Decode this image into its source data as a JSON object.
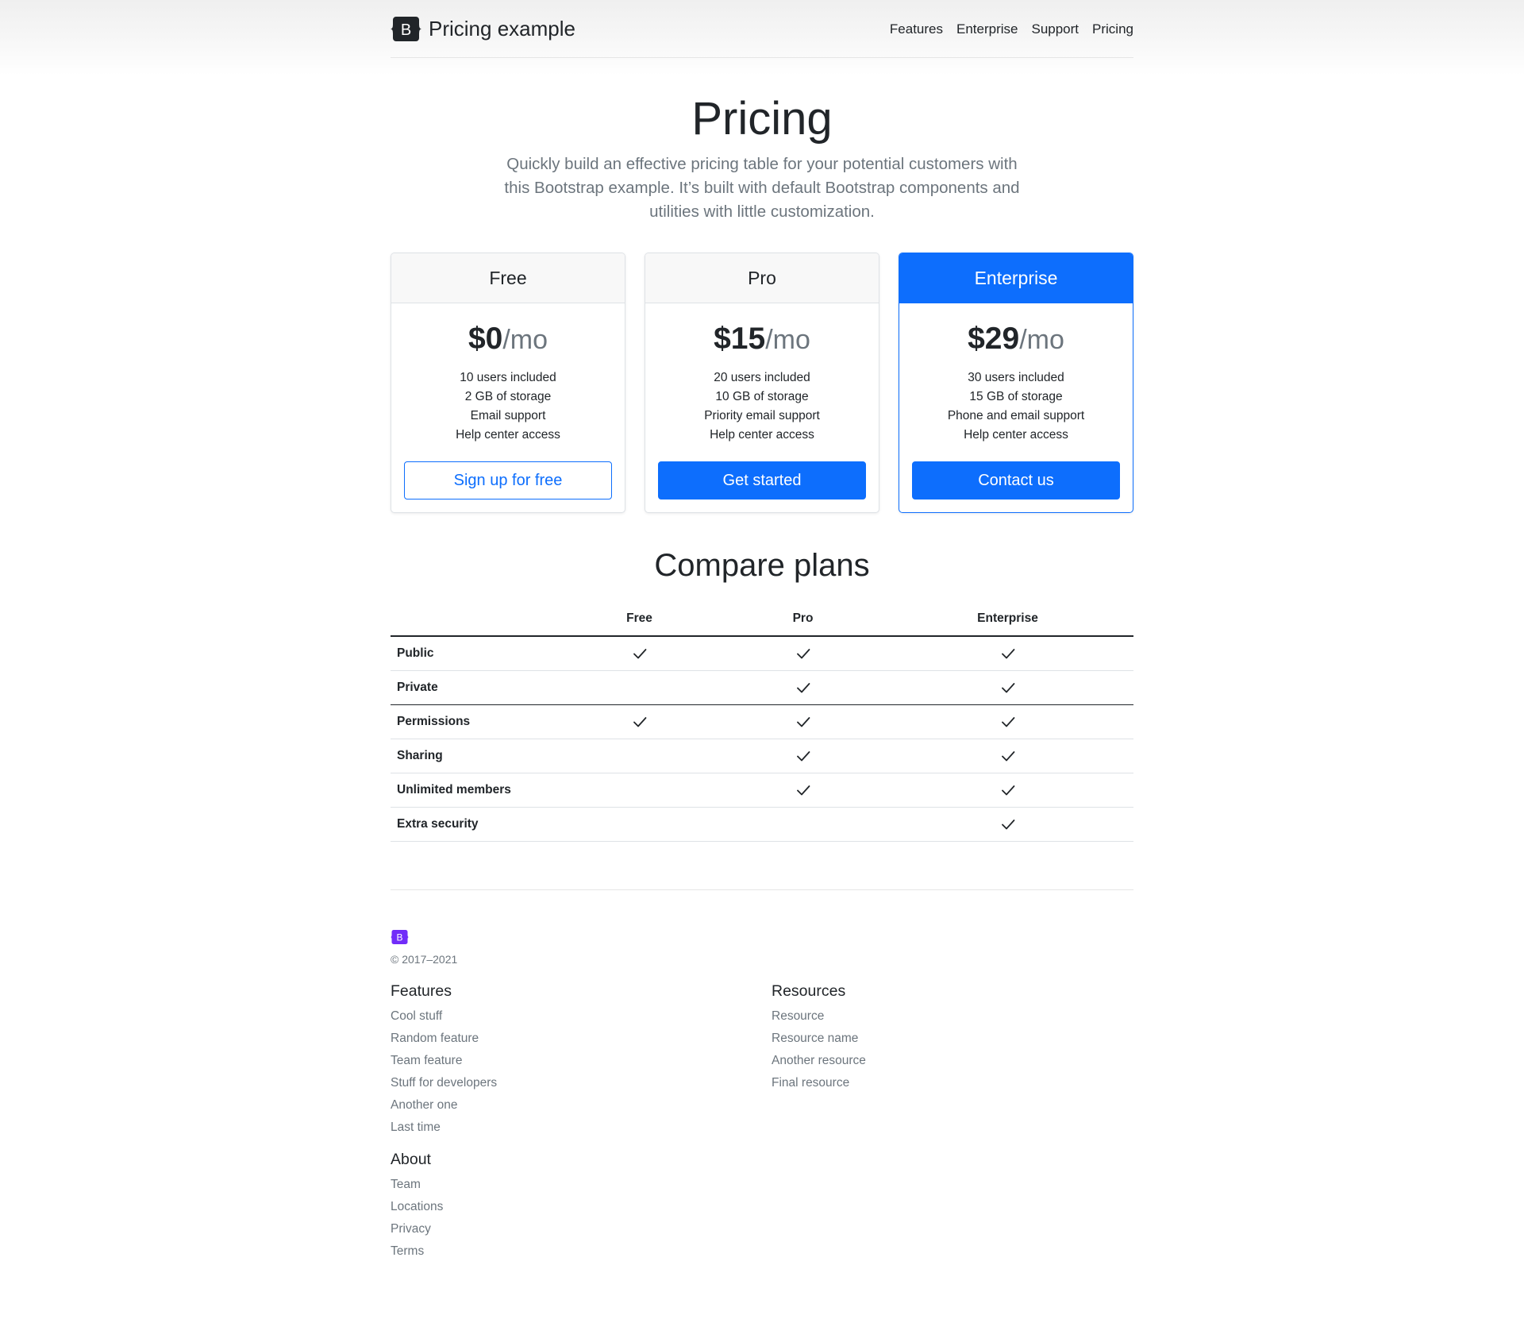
{
  "header": {
    "brand": "Pricing example",
    "nav": [
      "Features",
      "Enterprise",
      "Support",
      "Pricing"
    ]
  },
  "hero": {
    "title": "Pricing",
    "lead": "Quickly build an effective pricing table for your potential customers with this Bootstrap example. It’s built with default Bootstrap components and utilities with little customization."
  },
  "plans": [
    {
      "name": "Free",
      "amount": "$0",
      "period": "/mo",
      "features": [
        "10 users included",
        "2 GB of storage",
        "Email support",
        "Help center access"
      ],
      "button": "Sign up for free"
    },
    {
      "name": "Pro",
      "amount": "$15",
      "period": "/mo",
      "features": [
        "20 users included",
        "10 GB of storage",
        "Priority email support",
        "Help center access"
      ],
      "button": "Get started"
    },
    {
      "name": "Enterprise",
      "amount": "$29",
      "period": "/mo",
      "features": [
        "30 users included",
        "15 GB of storage",
        "Phone and email support",
        "Help center access"
      ],
      "button": "Contact us"
    }
  ],
  "compare": {
    "title": "Compare plans",
    "columns": [
      "Free",
      "Pro",
      "Enterprise"
    ],
    "rows": [
      {
        "label": "Public",
        "checks": [
          true,
          true,
          true
        ]
      },
      {
        "label": "Private",
        "checks": [
          false,
          true,
          true
        ]
      },
      {
        "label": "Permissions",
        "checks": [
          true,
          true,
          true
        ]
      },
      {
        "label": "Sharing",
        "checks": [
          false,
          true,
          true
        ]
      },
      {
        "label": "Unlimited members",
        "checks": [
          false,
          true,
          true
        ]
      },
      {
        "label": "Extra security",
        "checks": [
          false,
          false,
          true
        ]
      }
    ]
  },
  "footer": {
    "logo_letter": "B",
    "copyright": "© 2017–2021",
    "features": {
      "title": "Features",
      "links": [
        "Cool stuff",
        "Random feature",
        "Team feature",
        "Stuff for developers",
        "Another one",
        "Last time"
      ]
    },
    "resources": {
      "title": "Resources",
      "links": [
        "Resource",
        "Resource name",
        "Another resource",
        "Final resource"
      ]
    },
    "about": {
      "title": "About",
      "links": [
        "Team",
        "Locations",
        "Privacy",
        "Terms"
      ]
    }
  },
  "colors": {
    "primary": "#0d6efd",
    "footer_logo": "#712cf9",
    "muted": "#6c757d"
  }
}
